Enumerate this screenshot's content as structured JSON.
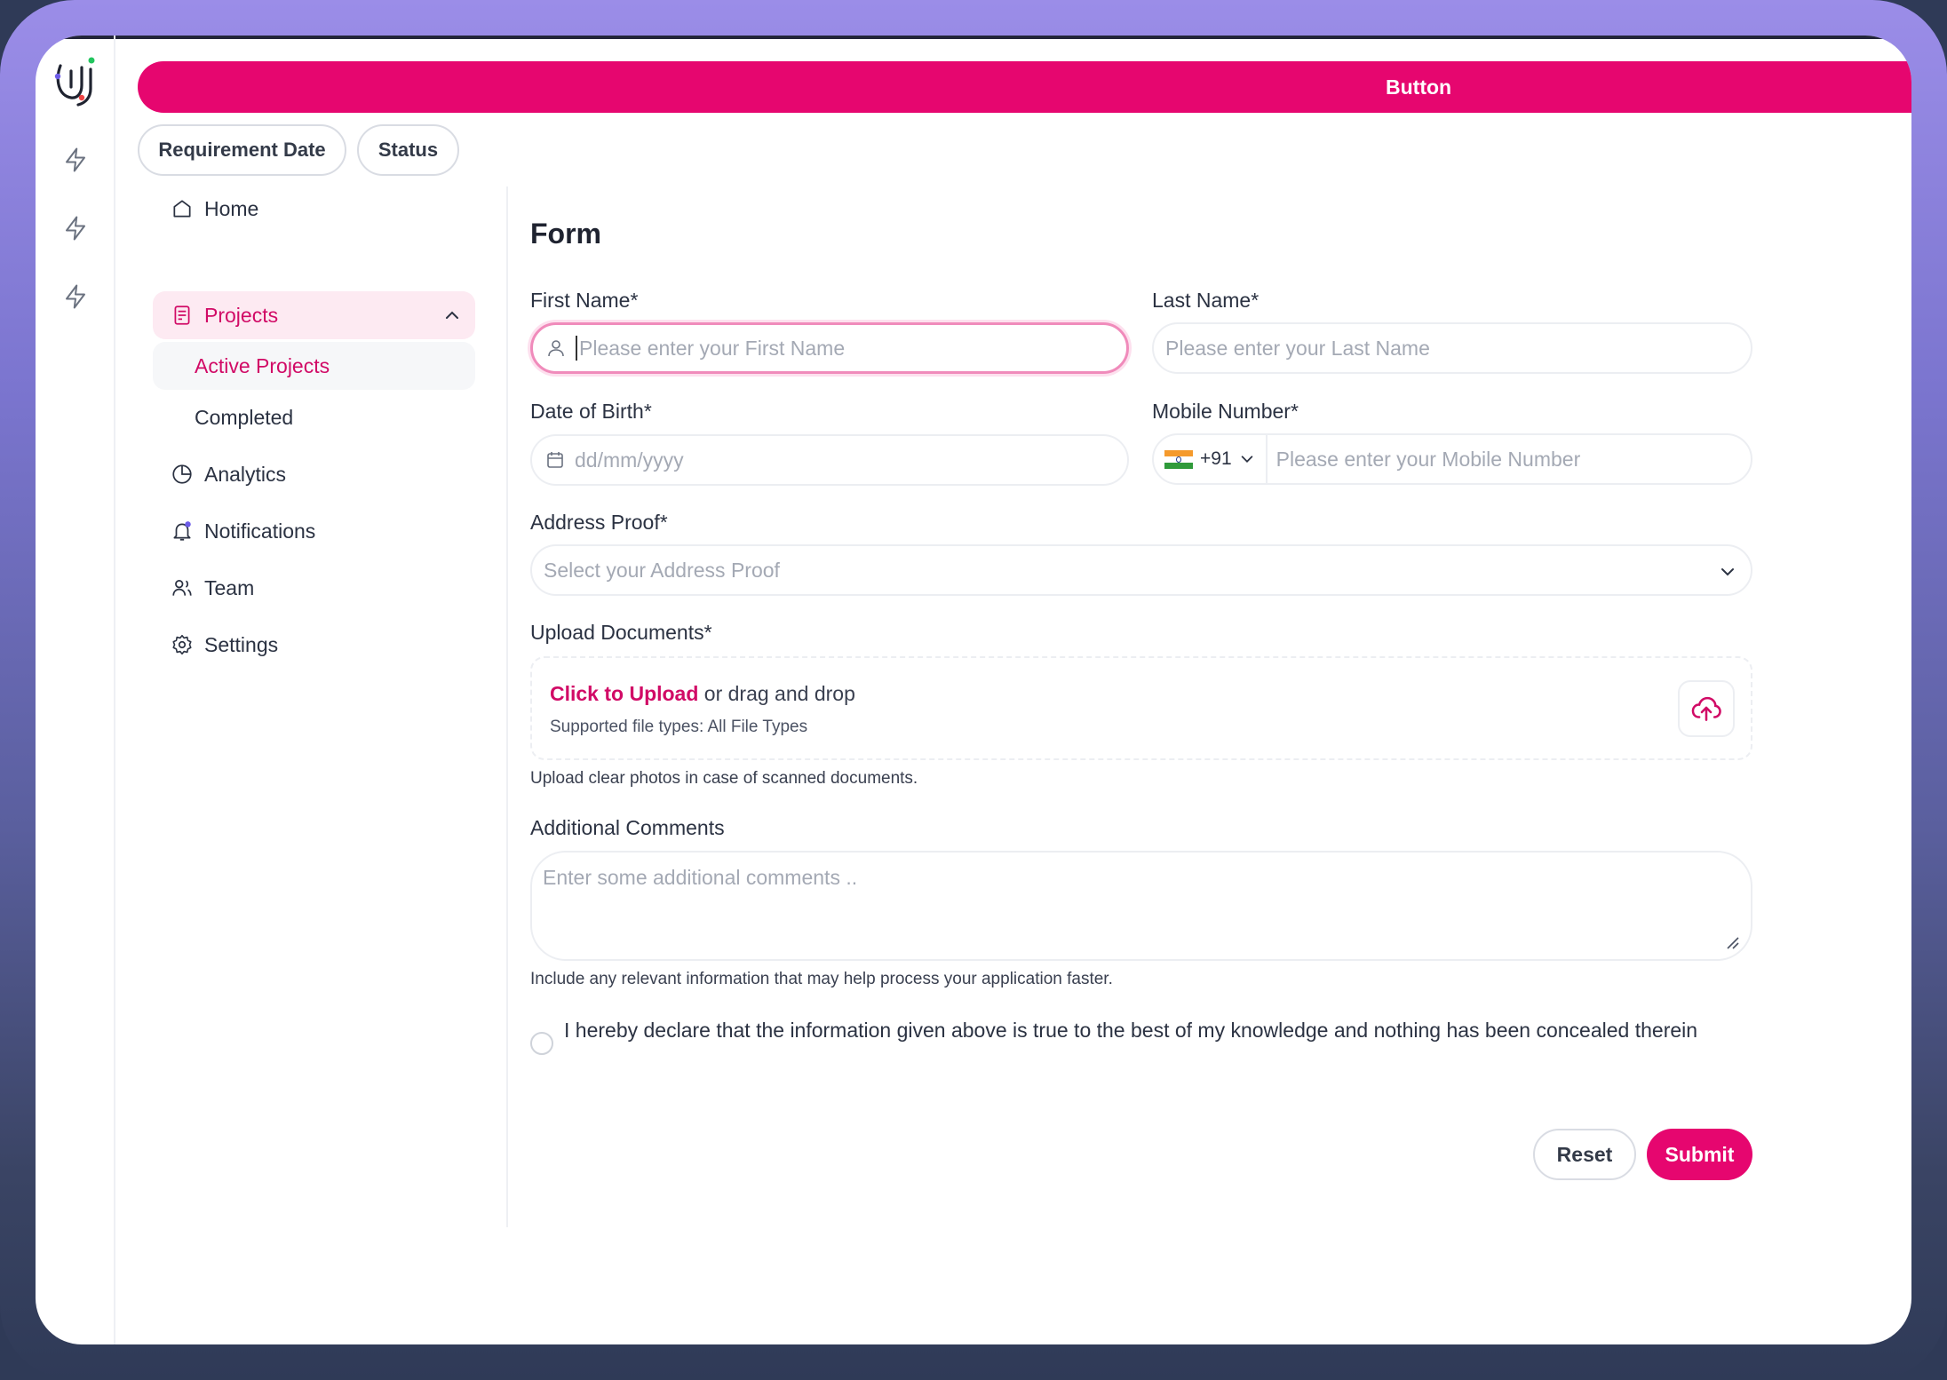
{
  "header": {
    "button_label": "Button"
  },
  "filters": [
    {
      "label": "Requirement Date"
    },
    {
      "label": "Status"
    }
  ],
  "sidebar": {
    "items": [
      {
        "label": "Home",
        "icon": "home-icon"
      },
      {
        "label": "Projects",
        "icon": "projects-icon",
        "expanded": true,
        "children": [
          {
            "label": "Active Projects",
            "active": true
          },
          {
            "label": "Completed"
          }
        ]
      },
      {
        "label": "Analytics",
        "icon": "pie-chart-icon"
      },
      {
        "label": "Notifications",
        "icon": "bell-icon"
      },
      {
        "label": "Team",
        "icon": "users-icon"
      },
      {
        "label": "Settings",
        "icon": "gear-icon"
      }
    ]
  },
  "form": {
    "title": "Form",
    "first_name": {
      "label": "First Name*",
      "placeholder": "Please enter your First Name"
    },
    "last_name": {
      "label": "Last Name*",
      "placeholder": "Please enter your Last Name"
    },
    "dob": {
      "label": "Date of Birth*",
      "placeholder": "dd/mm/yyyy"
    },
    "mobile": {
      "label": "Mobile Number*",
      "country_code": "+91",
      "placeholder": "Please enter your Mobile Number"
    },
    "address_proof": {
      "label": "Address Proof*",
      "placeholder": "Select your Address Proof"
    },
    "upload": {
      "label": "Upload Documents*",
      "link_text": "Click to Upload",
      "rest_text": " or drag and drop",
      "supported": "Supported file types: All File Types",
      "help": "Upload clear photos in case of scanned documents."
    },
    "comments": {
      "label": "Additional Comments",
      "placeholder": "Enter some additional comments ..",
      "help": "Include any relevant information that may help process your application faster."
    },
    "declaration": "I hereby declare that the information given above is true to the best of my knowledge and nothing has been concealed therein",
    "reset_label": "Reset",
    "submit_label": "Submit"
  },
  "colors": {
    "brand": "#e6066f",
    "brand_text": "#d10a66",
    "active_bg": "#fdeaf2"
  }
}
